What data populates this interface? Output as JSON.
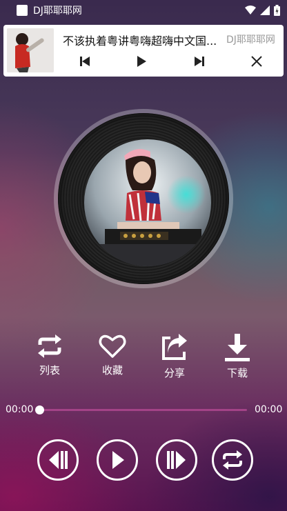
{
  "status_bar": {
    "app_name": "DJ耶耶耶网"
  },
  "notification": {
    "title": "不该执着粤讲粤嗨超嗨中文国...",
    "app_name": "DJ耶耶耶网",
    "buttons": [
      "previous-icon",
      "play-icon",
      "next-icon",
      "close-icon"
    ]
  },
  "actions": [
    {
      "label": "列表",
      "icon": "repeat-list-icon"
    },
    {
      "label": "收藏",
      "icon": "heart-icon"
    },
    {
      "label": "分享",
      "icon": "share-icon"
    },
    {
      "label": "下载",
      "icon": "download-icon"
    }
  ],
  "progress": {
    "current": "00:00",
    "total": "00:00",
    "fraction": 0.0
  },
  "controls": [
    "previous-icon",
    "play-icon",
    "next-icon",
    "repeat-mode-icon"
  ],
  "colors": {
    "card": "#ffffff",
    "track": "#aa468c",
    "accent": "#ffffff"
  }
}
